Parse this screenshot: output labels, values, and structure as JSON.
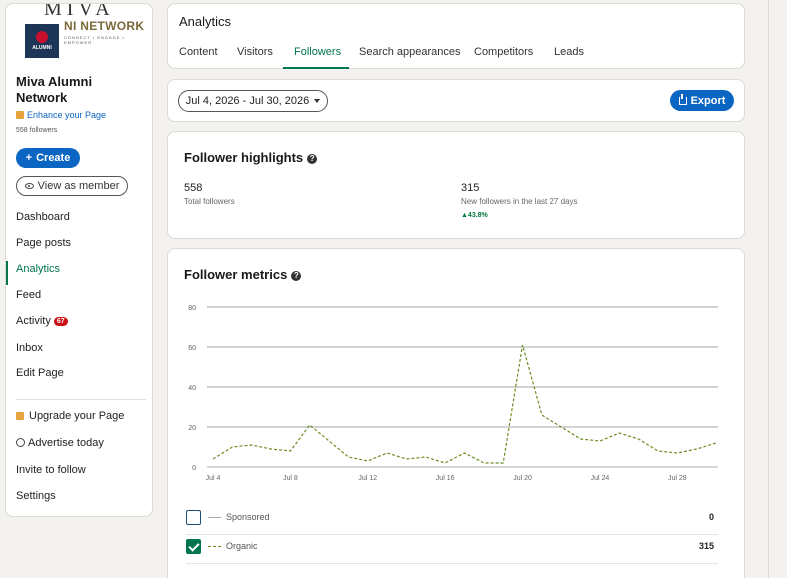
{
  "sidebar": {
    "banner": {
      "big": "MIVA",
      "net": "NI NETWORK",
      "tag": "CONNECT • ENGAGE • EMPOWER"
    },
    "logo_text": "ALUMNI",
    "org_name": "Miva Alumni Network",
    "enhance_label": "Enhance your Page",
    "followers_label": "558 followers",
    "create_label": "Create",
    "view_member_label": "View as member",
    "nav": [
      {
        "label": "Dashboard"
      },
      {
        "label": "Page posts"
      },
      {
        "label": "Analytics",
        "active": true
      },
      {
        "label": "Feed"
      },
      {
        "label": "Activity",
        "badge": "67"
      },
      {
        "label": "Inbox"
      },
      {
        "label": "Edit Page"
      }
    ],
    "upgrade_label": "Upgrade your Page",
    "advertise_label": "Advertise today",
    "invite_label": "Invite to follow",
    "settings_label": "Settings"
  },
  "header": {
    "title": "Analytics",
    "tabs": [
      {
        "label": "Content"
      },
      {
        "label": "Visitors"
      },
      {
        "label": "Followers",
        "active": true
      },
      {
        "label": "Search appearances"
      },
      {
        "label": "Competitors"
      },
      {
        "label": "Leads"
      }
    ]
  },
  "toolbar": {
    "date_range": "Jul 4, 2026 - Jul 30, 2026",
    "export_label": "Export"
  },
  "highlights": {
    "title": "Follower highlights",
    "total_value": "558",
    "total_label": "Total followers",
    "new_value": "315",
    "new_label": "New followers in the last 27 days",
    "new_delta": "▲43.8%"
  },
  "metrics": {
    "title": "Follower metrics",
    "legend": [
      {
        "label": "Sponsored",
        "value": "0",
        "checked": false
      },
      {
        "label": "Organic",
        "value": "315",
        "checked": true
      }
    ]
  },
  "colors": {
    "accent": "#0a66c2",
    "green": "#01754f",
    "series": "#6b8e23"
  },
  "chart_data": {
    "type": "line",
    "x_tick_labels": [
      "Jul 4",
      "Jul 8",
      "Jul 12",
      "Jul 16",
      "Jul 20",
      "Jul 24",
      "Jul 28"
    ],
    "y_ticks": [
      0,
      20,
      40,
      60,
      80
    ],
    "ylim": [
      0,
      80
    ],
    "grid": true,
    "series": [
      {
        "name": "Organic",
        "style": "dashed",
        "values": [
          4,
          10,
          11,
          9,
          8,
          21,
          13,
          5,
          3,
          7,
          4,
          5,
          2,
          7,
          2,
          2,
          61,
          26,
          20,
          14,
          13,
          17,
          14,
          8,
          7,
          9,
          12
        ]
      },
      {
        "name": "Sponsored",
        "style": "solid",
        "values": [
          0,
          0,
          0,
          0,
          0,
          0,
          0,
          0,
          0,
          0,
          0,
          0,
          0,
          0,
          0,
          0,
          0,
          0,
          0,
          0,
          0,
          0,
          0,
          0,
          0,
          0,
          0
        ]
      }
    ]
  }
}
